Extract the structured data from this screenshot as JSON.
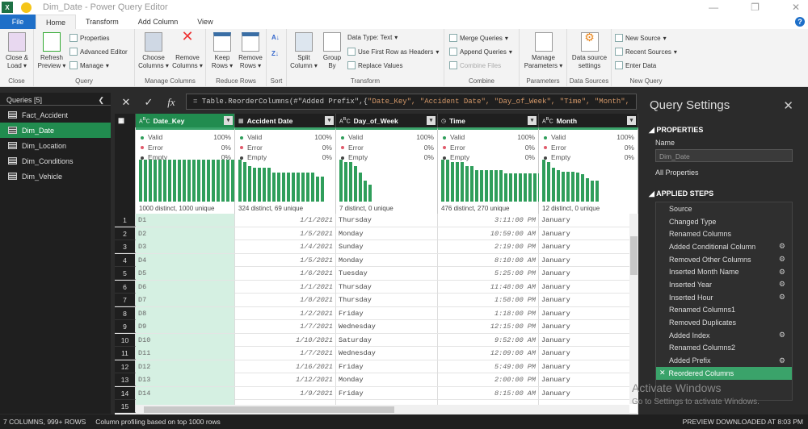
{
  "window": {
    "title": "Dim_Date - Power Query Editor",
    "app_icon": "X"
  },
  "tabs": [
    "File",
    "Home",
    "Transform",
    "Add Column",
    "View"
  ],
  "ribbon": {
    "close": {
      "close_load": "Close &",
      "close_load2": "Load",
      "group": "Close"
    },
    "query": {
      "refresh": "Refresh",
      "refresh2": "Preview",
      "properties": "Properties",
      "advanced_editor": "Advanced Editor",
      "manage": "Manage",
      "group": "Query"
    },
    "manage_columns": {
      "choose": "Choose",
      "choose2": "Columns",
      "remove": "Remove",
      "remove2": "Columns",
      "group": "Manage Columns"
    },
    "reduce_rows": {
      "keep": "Keep",
      "keep2": "Rows",
      "remove": "Remove",
      "remove2": "Rows",
      "group": "Reduce Rows"
    },
    "sort": {
      "group": "Sort"
    },
    "transform": {
      "split": "Split",
      "split2": "Column",
      "group_by": "Group",
      "group_by2": "By",
      "data_type": "Data Type: Text",
      "first_row": "Use First Row as Headers",
      "replace": "Replace Values",
      "group": "Transform"
    },
    "combine": {
      "merge": "Merge Queries",
      "append": "Append Queries",
      "combine_files": "Combine Files",
      "group": "Combine"
    },
    "parameters": {
      "manage": "Manage",
      "manage2": "Parameters",
      "group": "Parameters"
    },
    "data_sources": {
      "settings": "Data source",
      "settings2": "settings",
      "group": "Data Sources"
    },
    "new_query": {
      "new_source": "New Source",
      "recent": "Recent Sources",
      "enter": "Enter Data",
      "group": "New Query"
    }
  },
  "queries": {
    "header": "Queries [5]",
    "items": [
      "Fact_Accident",
      "Dim_Date",
      "Dim_Location",
      "Dim_Conditions",
      "Dim_Vehicle"
    ],
    "selected": 1
  },
  "formula": {
    "prefix": "= Table.ReorderColumns(#\"Added Prefix\",{",
    "args": "\"Date_Key\", \"Accident Date\", \"Day_of_Week\", \"Time\", \"Month\","
  },
  "columns": [
    {
      "name": "Date_Key",
      "type": "ABC",
      "valid": "100%",
      "error": "0%",
      "empty": "0%",
      "distinct": "1000 distinct, 1000 unique",
      "hist": [
        1,
        1,
        1,
        1,
        1,
        1,
        1,
        1,
        1,
        1,
        1,
        1,
        1,
        1,
        1,
        1,
        1,
        1,
        1,
        1
      ]
    },
    {
      "name": "Accident Date",
      "type": "cal",
      "valid": "100%",
      "error": "0%",
      "empty": "0%",
      "distinct": "324 distinct, 69 unique",
      "hist": [
        1,
        0.95,
        0.85,
        0.8,
        0.8,
        0.8,
        0.8,
        0.7,
        0.7,
        0.7,
        0.7,
        0.7,
        0.7,
        0.7,
        0.7,
        0.7,
        0.6,
        0.6
      ]
    },
    {
      "name": "Day_of_Week",
      "type": "ABC",
      "valid": "100%",
      "error": "0%",
      "empty": "0%",
      "distinct": "7 distinct, 0 unique",
      "hist": [
        1,
        0.95,
        0.95,
        0.85,
        0.7,
        0.5,
        0.4
      ]
    },
    {
      "name": "Time",
      "type": "clock",
      "valid": "100%",
      "error": "0%",
      "empty": "0%",
      "distinct": "476 distinct, 270 unique",
      "hist": [
        1,
        1,
        0.95,
        0.95,
        0.95,
        0.85,
        0.85,
        0.75,
        0.75,
        0.75,
        0.75,
        0.75,
        0.75,
        0.67,
        0.67,
        0.67,
        0.67,
        0.67,
        0.67,
        0.67,
        0.67
      ]
    },
    {
      "name": "Month",
      "type": "ABC",
      "valid": "100%",
      "error": "0%",
      "empty": "0%",
      "distinct": "12 distinct, 0 unique",
      "hist": [
        1,
        0.95,
        0.8,
        0.75,
        0.72,
        0.72,
        0.72,
        0.7,
        0.65,
        0.55,
        0.5,
        0.5
      ]
    }
  ],
  "profile_labels": {
    "valid": "Valid",
    "error": "Error",
    "empty": "Empty"
  },
  "rows": [
    [
      "1",
      "D1",
      "1/1/2021",
      "Thursday",
      "3:11:00 PM",
      "January"
    ],
    [
      "2",
      "D2",
      "1/5/2021",
      "Monday",
      "10:59:00 AM",
      "January"
    ],
    [
      "3",
      "D3",
      "1/4/2021",
      "Sunday",
      "2:19:00 PM",
      "January"
    ],
    [
      "4",
      "D4",
      "1/5/2021",
      "Monday",
      "8:10:00 AM",
      "January"
    ],
    [
      "5",
      "D5",
      "1/6/2021",
      "Tuesday",
      "5:25:00 PM",
      "January"
    ],
    [
      "6",
      "D6",
      "1/1/2021",
      "Thursday",
      "11:48:00 AM",
      "January"
    ],
    [
      "7",
      "D7",
      "1/8/2021",
      "Thursday",
      "1:58:00 PM",
      "January"
    ],
    [
      "8",
      "D8",
      "1/2/2021",
      "Friday",
      "1:18:00 PM",
      "January"
    ],
    [
      "9",
      "D9",
      "1/7/2021",
      "Wednesday",
      "12:15:00 PM",
      "January"
    ],
    [
      "10",
      "D10",
      "1/10/2021",
      "Saturday",
      "9:52:00 AM",
      "January"
    ],
    [
      "11",
      "D11",
      "1/7/2021",
      "Wednesday",
      "12:09:00 AM",
      "January"
    ],
    [
      "12",
      "D12",
      "1/16/2021",
      "Friday",
      "5:49:00 PM",
      "January"
    ],
    [
      "13",
      "D13",
      "1/12/2021",
      "Monday",
      "2:00:00 PM",
      "January"
    ],
    [
      "14",
      "D14",
      "1/9/2021",
      "Friday",
      "8:15:00 AM",
      "January"
    ],
    [
      "15",
      "",
      "",
      "",
      "",
      ""
    ]
  ],
  "settings": {
    "title": "Query Settings",
    "properties": "PROPERTIES",
    "name_label": "Name",
    "name_value": "Dim_Date",
    "all_properties": "All Properties",
    "applied_steps": "APPLIED STEPS",
    "steps": [
      {
        "label": "Source",
        "gear": false
      },
      {
        "label": "Changed Type",
        "gear": false
      },
      {
        "label": "Renamed Columns",
        "gear": false
      },
      {
        "label": "Added Conditional Column",
        "gear": true
      },
      {
        "label": "Removed Other Columns",
        "gear": true
      },
      {
        "label": "Inserted Month Name",
        "gear": true
      },
      {
        "label": "Inserted Year",
        "gear": true
      },
      {
        "label": "Inserted Hour",
        "gear": true
      },
      {
        "label": "Renamed Columns1",
        "gear": false
      },
      {
        "label": "Removed Duplicates",
        "gear": false
      },
      {
        "label": "Added Index",
        "gear": true
      },
      {
        "label": "Renamed Columns2",
        "gear": false
      },
      {
        "label": "Added Prefix",
        "gear": true
      },
      {
        "label": "Reordered Columns",
        "gear": false
      }
    ],
    "selected_step": 13
  },
  "watermark": {
    "line1": "Activate Windows",
    "line2": "Go to Settings to activate Windows."
  },
  "status": {
    "left1": "7 COLUMNS, 999+ ROWS",
    "left2": "Column profiling based on top 1000 rows",
    "right": "PREVIEW DOWNLOADED AT 8:03 PM"
  },
  "colors": {
    "accent": "#218c4f",
    "file_tab": "#1e6fc8",
    "bars": "#2f9e5b",
    "key_col": "#d5f0e2"
  }
}
